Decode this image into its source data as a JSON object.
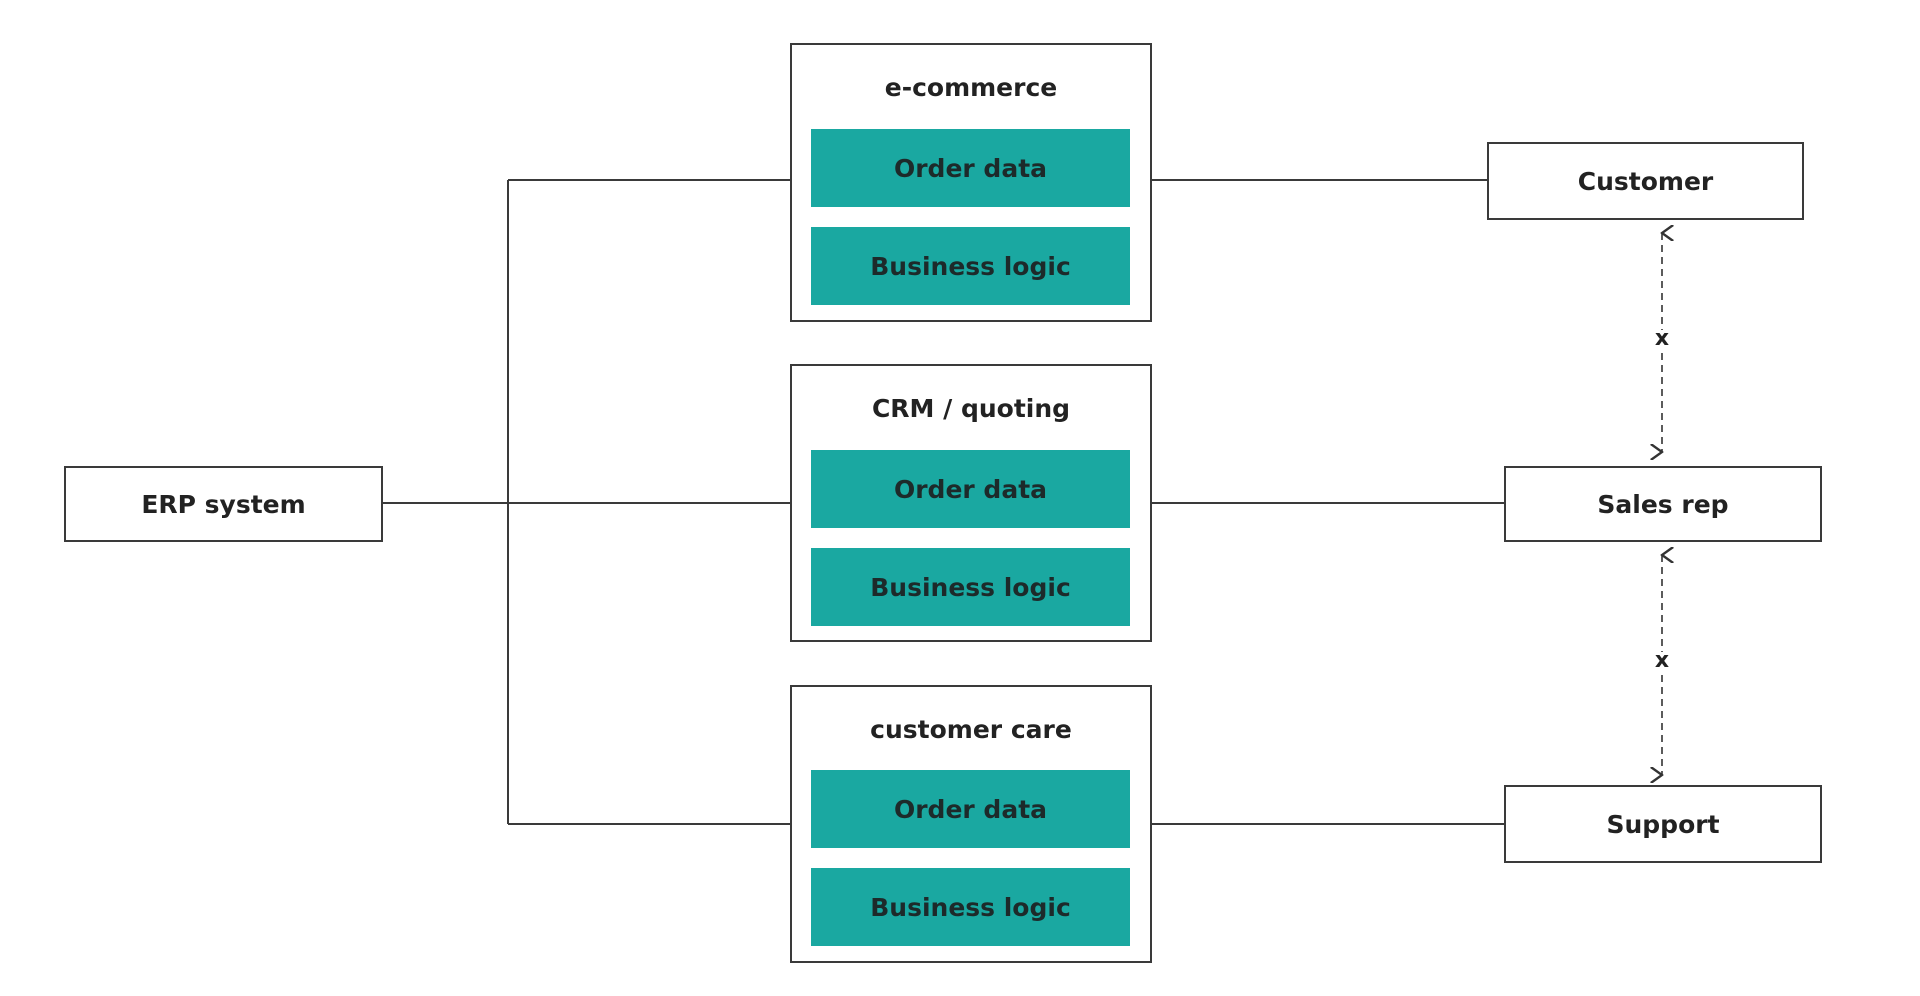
{
  "colors": {
    "accent": "#1aa8a1",
    "stroke": "#3a3a3a"
  },
  "erp": {
    "label": "ERP system"
  },
  "groups": [
    {
      "title": "e-commerce",
      "items": [
        "Order data",
        "Business logic"
      ]
    },
    {
      "title": "CRM / quoting",
      "items": [
        "Order data",
        "Business logic"
      ]
    },
    {
      "title": "customer care",
      "items": [
        "Order data",
        "Business logic"
      ]
    }
  ],
  "actors": [
    {
      "label": "Customer"
    },
    {
      "label": "Sales rep"
    },
    {
      "label": "Support"
    }
  ],
  "blocked_links": [
    {
      "marker": "x"
    },
    {
      "marker": "x"
    }
  ]
}
